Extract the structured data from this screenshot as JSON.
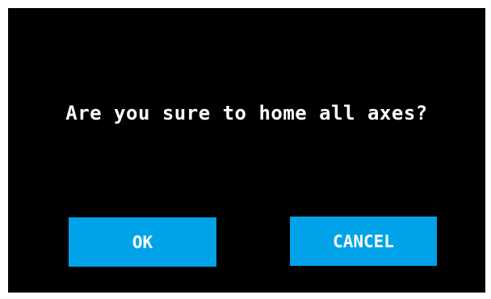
{
  "dialog": {
    "question": "Are you sure to home all axes?",
    "ok_label": "OK",
    "cancel_label": "CANCEL"
  },
  "colors": {
    "screen_background": "#000000",
    "button_background": "#00a3e8",
    "text": "#ffffff",
    "bezel": "#ffffff"
  }
}
